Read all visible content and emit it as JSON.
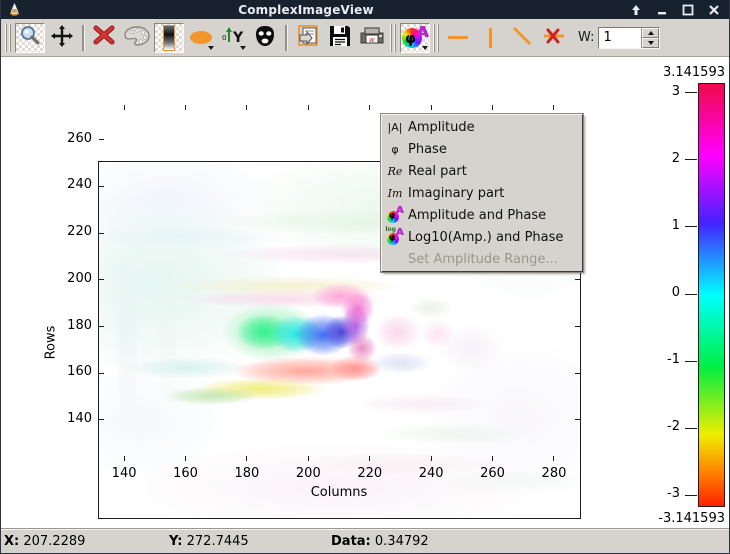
{
  "window": {
    "title": "ComplexImageView",
    "controls": [
      "shade",
      "minimize",
      "maximize",
      "close"
    ]
  },
  "toolbar": {
    "buttons": [
      "zoom",
      "pan",
      "delete-roi",
      "palette",
      "colorbar-toggle",
      "ellipse-roi",
      "axes-mode",
      "mask",
      "copy-view",
      "save",
      "print",
      "complex-display-mode",
      "profile-horizontal",
      "profile-vertical",
      "profile-diagonal",
      "profile-delete"
    ],
    "selected_buttons": [
      "zoom",
      "colorbar-toggle",
      "complex-display-mode"
    ],
    "width_label": "W:",
    "width_value": "1",
    "accent_color": "#f0962c"
  },
  "menu": {
    "items": [
      {
        "icon": "amplitude-icon",
        "glyph": "|A|",
        "serif": false,
        "wheel": false,
        "log": false,
        "label": "Amplitude",
        "enabled": true
      },
      {
        "icon": "phase-icon",
        "glyph": "φ",
        "serif": false,
        "wheel": false,
        "log": false,
        "label": "Phase",
        "enabled": true
      },
      {
        "icon": "real-part-icon",
        "glyph": "Re",
        "serif": true,
        "wheel": false,
        "log": false,
        "label": "Real part",
        "enabled": true
      },
      {
        "icon": "imaginary-part-icon",
        "glyph": "Im",
        "serif": true,
        "wheel": false,
        "log": false,
        "label": "Imaginary part",
        "enabled": true
      },
      {
        "icon": "amplitude-phase-icon",
        "glyph": "",
        "serif": false,
        "wheel": true,
        "log": false,
        "label": "Amplitude and Phase",
        "enabled": true
      },
      {
        "icon": "log-amplitude-phase-icon",
        "glyph": "",
        "serif": false,
        "wheel": true,
        "log": true,
        "label": "Log10(Amp.) and Phase",
        "enabled": true
      },
      {
        "icon": "none",
        "glyph": "",
        "serif": false,
        "wheel": false,
        "log": false,
        "label": "Set Amplitude Range...",
        "enabled": false
      }
    ]
  },
  "plot": {
    "xlabel": "Columns",
    "ylabel": "Rows",
    "x_ticks": [
      140,
      160,
      180,
      200,
      220,
      240,
      260,
      280
    ],
    "y_ticks": [
      260,
      240,
      220,
      200,
      180,
      160,
      140
    ],
    "x_range": [
      131.5,
      288.8
    ],
    "y_range": [
      122.0,
      275.3
    ],
    "image_blobs": [
      [
        60,
        120,
        130,
        95,
        212,
        240,
        232,
        0.6
      ],
      [
        300,
        45,
        170,
        55,
        222,
        245,
        226,
        0.6
      ],
      [
        430,
        70,
        100,
        70,
        228,
        246,
        236,
        0.5
      ],
      [
        70,
        35,
        110,
        45,
        232,
        238,
        250,
        0.5
      ],
      [
        240,
        325,
        210,
        45,
        248,
        236,
        244,
        0.6
      ],
      [
        420,
        255,
        100,
        75,
        242,
        238,
        248,
        0.45
      ],
      [
        40,
        260,
        90,
        60,
        236,
        244,
        250,
        0.5
      ],
      [
        250,
        92,
        130,
        10,
        243,
        212,
        232,
        0.6
      ],
      [
        190,
        124,
        115,
        10,
        240,
        233,
        184,
        0.65
      ],
      [
        185,
        137,
        105,
        9,
        246,
        200,
        224,
        0.6
      ],
      [
        265,
        60,
        150,
        13,
        222,
        242,
        218,
        0.55
      ],
      [
        90,
        75,
        100,
        12,
        225,
        240,
        246,
        0.5
      ],
      [
        172,
        170,
        50,
        30,
        143,
        240,
        176,
        0.85
      ],
      [
        165,
        170,
        28,
        18,
        46,
        242,
        142,
        0.95
      ],
      [
        197,
        172,
        26,
        19,
        32,
        232,
        232,
        0.95
      ],
      [
        224,
        173,
        28,
        21,
        47,
        98,
        242,
        0.92
      ],
      [
        243,
        170,
        19,
        17,
        68,
        54,
        216,
        0.9
      ],
      [
        257,
        163,
        14,
        21,
        176,
        80,
        224,
        0.85
      ],
      [
        259,
        146,
        17,
        17,
        240,
        96,
        200,
        0.8
      ],
      [
        242,
        134,
        30,
        13,
        255,
        143,
        208,
        0.75
      ],
      [
        263,
        186,
        15,
        14,
        224,
        96,
        176,
        0.7
      ],
      [
        207,
        209,
        75,
        14,
        255,
        144,
        128,
        0.8
      ],
      [
        257,
        206,
        26,
        13,
        255,
        120,
        120,
        0.7
      ],
      [
        162,
        227,
        65,
        11,
        237,
        231,
        90,
        0.78
      ],
      [
        112,
        234,
        48,
        9,
        168,
        220,
        144,
        0.65
      ],
      [
        88,
        206,
        62,
        11,
        184,
        232,
        224,
        0.55
      ],
      [
        299,
        170,
        23,
        18,
        248,
        200,
        228,
        0.7
      ],
      [
        339,
        172,
        17,
        14,
        250,
        212,
        236,
        0.6
      ],
      [
        302,
        201,
        30,
        11,
        200,
        208,
        242,
        0.6
      ],
      [
        332,
        146,
        22,
        10,
        216,
        232,
        200,
        0.5
      ],
      [
        372,
        186,
        32,
        24,
        240,
        228,
        244,
        0.5
      ],
      [
        322,
        242,
        65,
        10,
        244,
        220,
        232,
        0.5
      ],
      [
        352,
        272,
        75,
        10,
        222,
        240,
        220,
        0.45
      ],
      [
        300,
        302,
        95,
        12,
        248,
        232,
        236,
        0.5
      ],
      [
        420,
        320,
        80,
        12,
        236,
        244,
        238,
        0.45
      ],
      [
        28,
        170,
        13,
        85,
        228,
        238,
        248,
        0.5
      ],
      [
        68,
        170,
        11,
        75,
        234,
        244,
        238,
        0.5
      ]
    ]
  },
  "colorbar": {
    "top_label": "3.141593",
    "bottom_label": "-3.141593",
    "tick_values": [
      3,
      2,
      1,
      0,
      -1,
      -2,
      -3
    ],
    "value_max": 3.141593,
    "value_min": -3.141593,
    "gradient_stops": [
      {
        "pos": 0,
        "color": "#f00a4a"
      },
      {
        "pos": 17,
        "color": "#ff00ff"
      },
      {
        "pos": 33,
        "color": "#4422ff"
      },
      {
        "pos": 50,
        "color": "#00ffff"
      },
      {
        "pos": 67,
        "color": "#00ee44"
      },
      {
        "pos": 83,
        "color": "#eeee00"
      },
      {
        "pos": 93,
        "color": "#ff7700"
      },
      {
        "pos": 100,
        "color": "#ff2200"
      }
    ]
  },
  "statusbar": {
    "x_label": "X:",
    "x_value": "207.2289",
    "y_label": "Y:",
    "y_value": "272.7445",
    "data_label": "Data:",
    "data_value": "0.34792"
  }
}
